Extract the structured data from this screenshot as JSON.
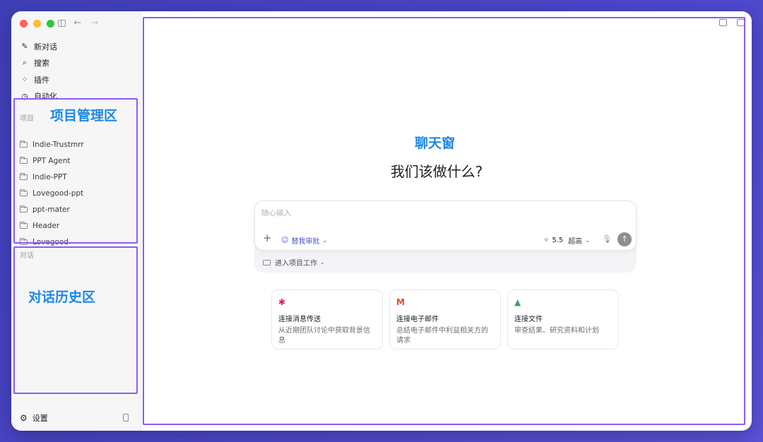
{
  "menu": [
    {
      "label": "新对话",
      "icon": "edit-icon"
    },
    {
      "label": "搜索",
      "icon": "search-icon"
    },
    {
      "label": "插件",
      "icon": "plugins-icon"
    },
    {
      "label": "自动化",
      "icon": "clock-icon"
    }
  ],
  "projects_label": "项目",
  "projects": [
    "Indie-Trustmrr",
    "PPT Agent",
    "Indie-PPT",
    "Lovegood-ppt",
    "ppt-mater",
    "Header",
    "Lovegood"
  ],
  "conversations_label": "对话",
  "annotations": {
    "project_area": "项目管理区",
    "history_area": "对话历史区",
    "chat_area": "聊天窗"
  },
  "settings_label": "设置",
  "headline": "我们该做什么?",
  "composer": {
    "placeholder": "随心输入",
    "approve_label": "替我审批",
    "model_version": "5.5",
    "model_level": "超高"
  },
  "project_work_label": "进入项目工作",
  "cards": [
    {
      "title": "连接消息传送",
      "desc": "从近期团队讨论中获取背景信息",
      "icon": "slack-icon"
    },
    {
      "title": "连接电子邮件",
      "desc": "总结电子邮件中利益相关方的请求",
      "icon": "gmail-icon"
    },
    {
      "title": "连接文件",
      "desc": "审查结果、研究资料和计划",
      "icon": "drive-icon"
    }
  ],
  "colors": {
    "annotation_border": "#8b5cf6",
    "annotation_text": "#1e88e5",
    "background_gradient": "#4b46c9"
  }
}
